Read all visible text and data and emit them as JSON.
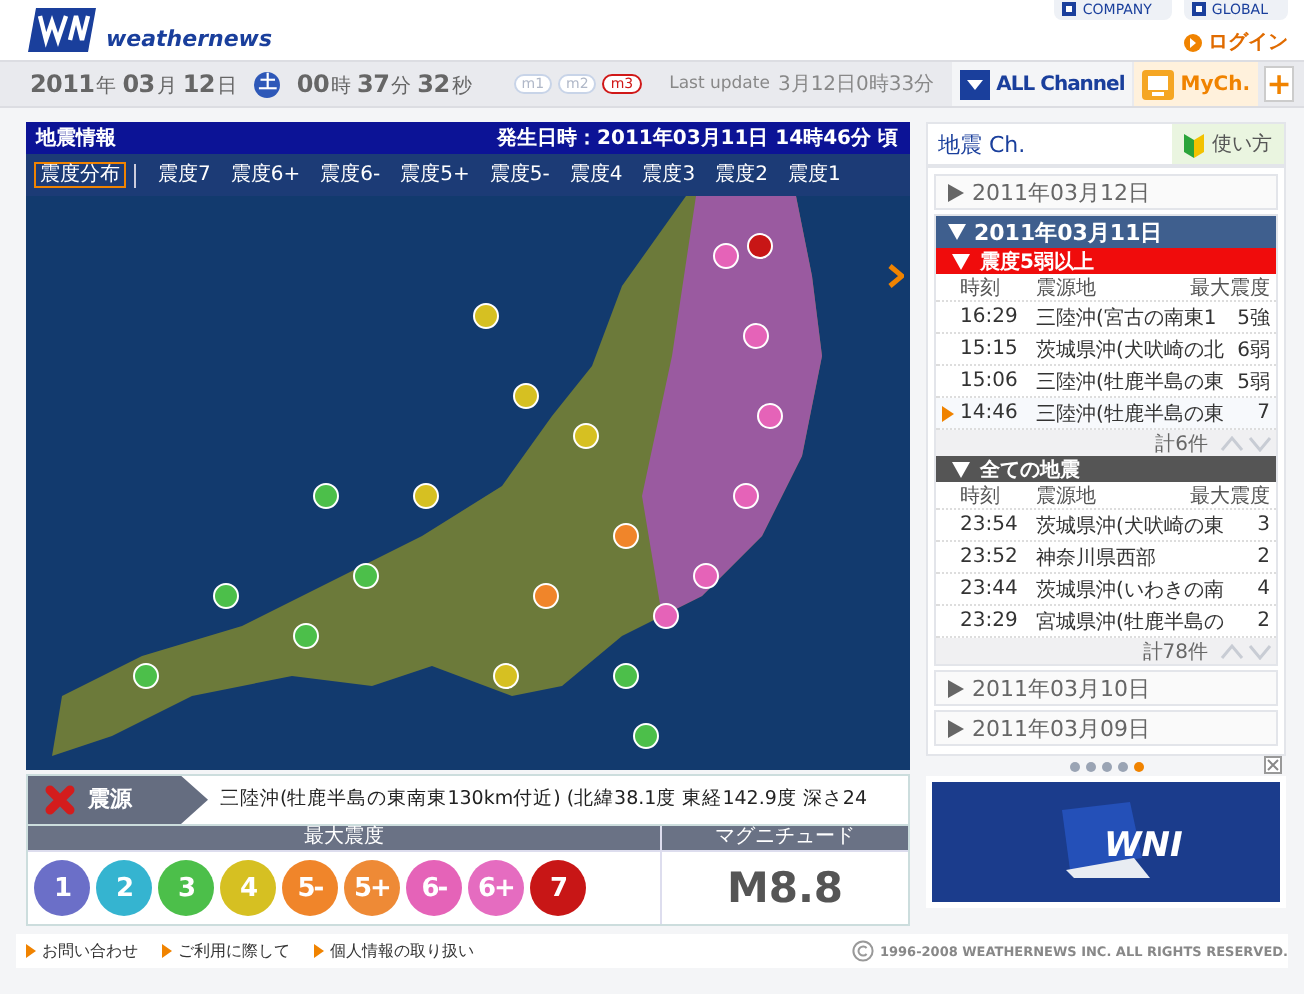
{
  "header": {
    "brand": "weathernews",
    "top_links": [
      "COMPANY",
      "GLOBAL"
    ],
    "login": "ログイン"
  },
  "clock": {
    "parts": [
      {
        "value": "2011",
        "unit": "年"
      },
      {
        "value": "03",
        "unit": "月"
      },
      {
        "value": "12",
        "unit": "日"
      }
    ],
    "weekday": "土",
    "time": [
      {
        "value": "00",
        "unit": "時"
      },
      {
        "value": "37",
        "unit": "分"
      },
      {
        "value": "32",
        "unit": "秒"
      }
    ],
    "modes": [
      {
        "label": "m1",
        "selected": false
      },
      {
        "label": "m2",
        "selected": false
      },
      {
        "label": "m3",
        "selected": true
      }
    ],
    "update_label": "Last update",
    "update_value": "3月12日0時33分"
  },
  "channels": [
    {
      "label": "ALL Channel",
      "kind": "all"
    },
    {
      "label": "MyCh.",
      "kind": "my"
    },
    {
      "label": "+",
      "kind": "add"
    }
  ],
  "panel": {
    "title": "地震情報",
    "occurred": "発生日時：2011年03月11日 14時46分 頃",
    "filters": [
      {
        "label": "震度分布",
        "selected": true
      },
      {
        "label": "震度7",
        "selected": false
      },
      {
        "label": "震度6+",
        "selected": false
      },
      {
        "label": "震度6-",
        "selected": false
      },
      {
        "label": "震度5+",
        "selected": false
      },
      {
        "label": "震度5-",
        "selected": false
      },
      {
        "label": "震度4",
        "selected": false
      },
      {
        "label": "震度3",
        "selected": false
      },
      {
        "label": "震度2",
        "selected": false
      },
      {
        "label": "震度1",
        "selected": false
      }
    ],
    "epicenter_label": "震源",
    "epicenter_text": "三陸沖(牡鹿半島の東南東130km付近) (北緯38.1度 東経142.9度 深さ24",
    "intensity_heading": "最大震度",
    "intensities": [
      {
        "label": "1",
        "color": "#6b6fc8"
      },
      {
        "label": "2",
        "color": "#35b4d0"
      },
      {
        "label": "3",
        "color": "#4cbf4a"
      },
      {
        "label": "4",
        "color": "#d6c022"
      },
      {
        "label": "5-",
        "color": "#f0852a"
      },
      {
        "label": "5+",
        "color": "#ee8a36"
      },
      {
        "label": "6-",
        "color": "#e563b8"
      },
      {
        "label": "6+",
        "color": "#e56cc0"
      },
      {
        "label": "7",
        "color": "#c81616"
      }
    ],
    "magnitude_heading": "マグニチュード",
    "magnitude": "M8.8"
  },
  "sidebar": {
    "title": "地震 Ch.",
    "help": "使い方",
    "days": [
      {
        "label": "2011年03月12日",
        "expanded": false
      },
      {
        "label": "2011年03月11日",
        "expanded": true,
        "sections": [
          {
            "label": "震度5弱以上",
            "kind": "strong",
            "columns": [
              "時刻",
              "震源地",
              "最大震度"
            ],
            "rows": [
              {
                "time": "16:29",
                "place": "三陸沖(宮古の南東1",
                "max": "5強",
                "selected": false
              },
              {
                "time": "15:15",
                "place": "茨城県沖(犬吠崎の北",
                "max": "6弱",
                "selected": false
              },
              {
                "time": "15:06",
                "place": "三陸沖(牡鹿半島の東",
                "max": "5弱",
                "selected": false
              },
              {
                "time": "14:46",
                "place": "三陸沖(牡鹿半島の東",
                "max": "7",
                "selected": true
              }
            ],
            "total": "計6件"
          },
          {
            "label": "全ての地震",
            "kind": "all",
            "columns": [
              "時刻",
              "震源地",
              "最大震度"
            ],
            "rows": [
              {
                "time": "23:54",
                "place": "茨城県沖(犬吠崎の東",
                "max": "3",
                "selected": false
              },
              {
                "time": "23:52",
                "place": "神奈川県西部",
                "max": "2",
                "selected": false
              },
              {
                "time": "23:44",
                "place": "茨城県沖(いわきの南",
                "max": "4",
                "selected": false
              },
              {
                "time": "23:29",
                "place": "宮城県沖(牡鹿半島の",
                "max": "2",
                "selected": false
              }
            ],
            "total": "計78件"
          }
        ]
      },
      {
        "label": "2011年03月10日",
        "expanded": false
      },
      {
        "label": "2011年03月09日",
        "expanded": false
      }
    ],
    "carousel": [
      {
        "selected": false
      },
      {
        "selected": false
      },
      {
        "selected": false
      },
      {
        "selected": false
      },
      {
        "selected": true
      }
    ],
    "banner": "WNI"
  },
  "footer": {
    "links": [
      "お問い合わせ",
      "ご利用に際して",
      "個人情報の取り扱い"
    ],
    "copyright": "1996-2008 WEATHERNEWS INC. ALL RIGHTS RESERVED."
  }
}
